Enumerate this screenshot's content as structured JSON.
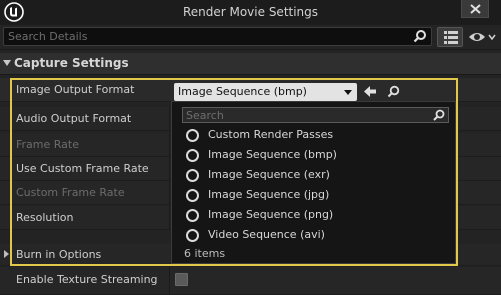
{
  "window": {
    "title": "Render Movie Settings"
  },
  "toolbar": {
    "search_placeholder": "Search Details"
  },
  "section": {
    "title": "Capture Settings"
  },
  "rows": [
    {
      "label": "Image Output Format",
      "enabled": true
    },
    {
      "label": "Audio Output Format",
      "enabled": true
    },
    {
      "label": "Frame Rate",
      "enabled": false
    },
    {
      "label": "Use Custom Frame Rate",
      "enabled": true
    },
    {
      "label": "Custom Frame Rate",
      "enabled": false
    },
    {
      "label": "Resolution",
      "enabled": true
    }
  ],
  "combo": {
    "selected": "Image Sequence (bmp)"
  },
  "popup": {
    "search_placeholder": "Search",
    "options": [
      "Custom Render Passes",
      "Image Sequence (bmp)",
      "Image Sequence (exr)",
      "Image Sequence (jpg)",
      "Image Sequence (png)",
      "Video Sequence (avi)"
    ],
    "count_label": "6 items"
  },
  "lower": {
    "burn_in_label": "Burn in Options",
    "texture_streaming_label": "Enable Texture Streaming",
    "texture_streaming_checked": false
  },
  "colors": {
    "highlight": "#e2c84a",
    "panel": "#232323"
  },
  "icons": [
    "unreal-logo-icon",
    "close-icon",
    "search-icon",
    "grid-view-icon",
    "eye-icon",
    "reset-arrow-icon",
    "browse-icon"
  ]
}
